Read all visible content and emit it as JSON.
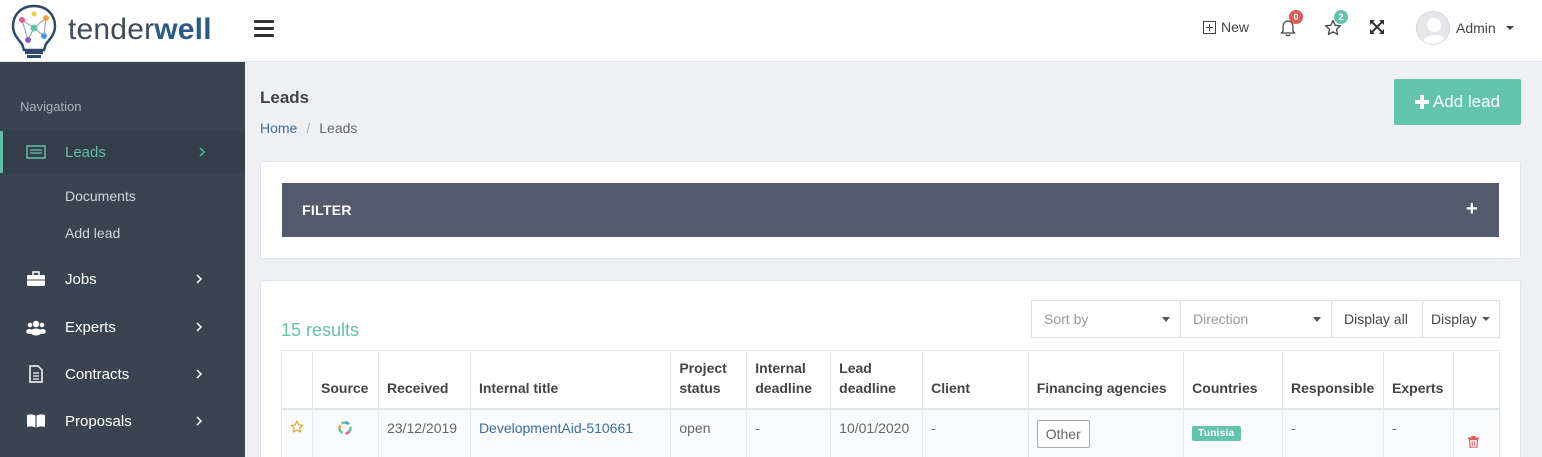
{
  "brand": {
    "name_light": "tender",
    "name_bold": "well"
  },
  "topbar": {
    "new_label": "New",
    "notifications_count": "0",
    "favorites_count": "2",
    "user_name": "Admin"
  },
  "sidebar": {
    "title": "Navigation",
    "items": [
      {
        "label": "Leads",
        "icon": "list-icon",
        "active": true
      },
      {
        "label": "Jobs",
        "icon": "briefcase-icon"
      },
      {
        "label": "Experts",
        "icon": "users-icon"
      },
      {
        "label": "Contracts",
        "icon": "document-icon"
      },
      {
        "label": "Proposals",
        "icon": "book-icon"
      }
    ],
    "sub_items": [
      "Documents",
      "Add lead"
    ]
  },
  "page": {
    "title": "Leads",
    "breadcrumb": {
      "home": "Home",
      "current": "Leads"
    },
    "add_button": "Add lead"
  },
  "filter": {
    "label": "FILTER",
    "plus": "+"
  },
  "results": {
    "text": "15 results"
  },
  "controls": {
    "sort_placeholder": "Sort by",
    "direction_placeholder": "Direction",
    "display_all": "Display all",
    "display": "Display"
  },
  "table": {
    "headers": [
      "",
      "Source",
      "Received",
      "Internal title",
      "Project status",
      "Internal deadline",
      "Lead deadline",
      "Client",
      "Financing agencies",
      "Countries",
      "Responsible",
      "Experts",
      ""
    ],
    "rows": [
      {
        "received": "23/12/2019",
        "title": "DevelopmentAid-510661",
        "status": "open",
        "internal_deadline": "-",
        "lead_deadline": "10/01/2020",
        "client": "-",
        "agency": "Other",
        "country": "Tunisia",
        "responsible": "-",
        "experts": "-"
      }
    ]
  },
  "colors": {
    "accent": "#62c4ab",
    "sidebar": "#3a4451",
    "filter_bar": "#535b6c",
    "link": "#3c6e9e"
  }
}
